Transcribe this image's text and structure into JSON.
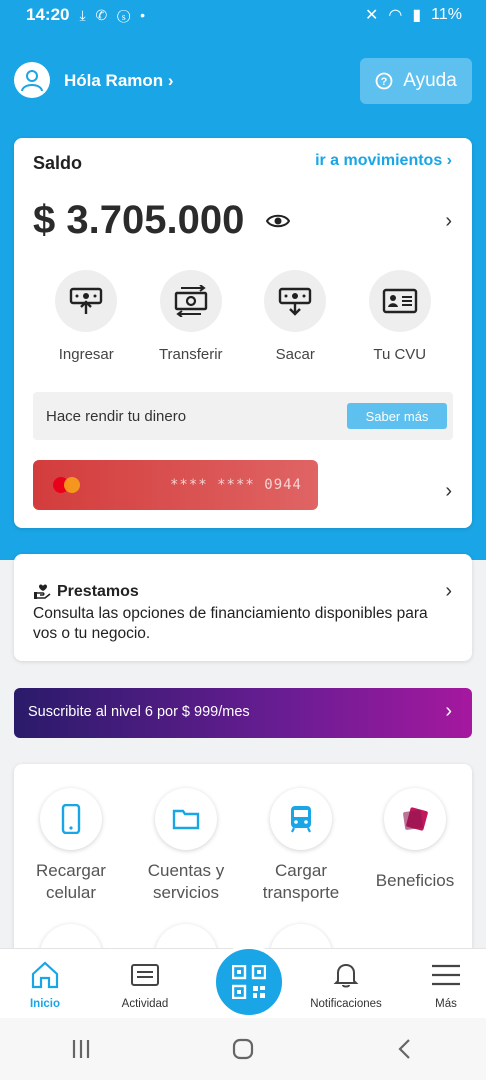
{
  "status_bar": {
    "time": "14:20",
    "notif": "⤓ ✆ ⓢ •",
    "battery": "11%"
  },
  "header": {
    "greeting": "Hóla Ramon",
    "help_label": "Ayuda"
  },
  "saldo": {
    "title": "Saldo",
    "movements_link": "ir a movimientos",
    "amount": "$ 3.705.000",
    "actions": [
      "Ingresar",
      "Transferir",
      "Sacar",
      "Tu CVU"
    ],
    "invest_text": "Hace rendir tu dinero",
    "invest_button": "Saber más",
    "card_number": "**** **** 0944"
  },
  "prestamos": {
    "title": "Prestamos",
    "description": "Consulta las opciones de financiamiento disponibles para vos o tu negocio."
  },
  "promo": {
    "text": "Suscribite al nivel 6 por $ 999/mes"
  },
  "services": [
    {
      "label": "Recargar celular",
      "icon": "phone-icon"
    },
    {
      "label": "Cuentas y servicios",
      "icon": "folder-icon"
    },
    {
      "label": "Cargar transporte",
      "icon": "bus-icon"
    },
    {
      "label": "Beneficios",
      "icon": "tag-icon"
    }
  ],
  "bottom_nav": [
    "Inicio",
    "Actividad",
    "Notificaciones",
    "Más"
  ],
  "colors": {
    "primary": "#1aa5e6",
    "card_red": "#d33c3c",
    "promo_start": "#2a1b6a",
    "promo_end": "#a5189f"
  }
}
